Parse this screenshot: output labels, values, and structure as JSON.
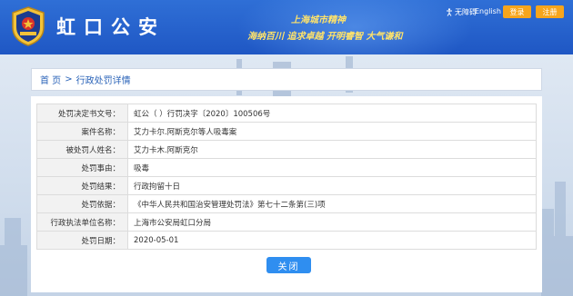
{
  "header": {
    "site_title": "虹口公安",
    "slogan_line1": "上海城市精神",
    "slogan_line2": "海纳百川 追求卓越 开明睿智 大气谦和",
    "accessible_label": "无障碍",
    "english_label": "English",
    "login_label": "登录",
    "register_label": "注册"
  },
  "breadcrumb": {
    "home": "首 页",
    "separator": ">",
    "current": "行政处罚详情"
  },
  "detail": {
    "rows": [
      {
        "label": "处罚决定书文号：",
        "value": "虹公（ ）行罚决字〔2020〕100506号"
      },
      {
        "label": "案件名称：",
        "value": "艾力卡尔.阿斯克尔等人吸毒案"
      },
      {
        "label": "被处罚人姓名：",
        "value": "艾力卡木.阿斯克尔"
      },
      {
        "label": "处罚事由：",
        "value": "吸毒"
      },
      {
        "label": "处罚结果：",
        "value": "行政拘留十日"
      },
      {
        "label": "处罚依据：",
        "value": "《中华人民共和国治安管理处罚法》第七十二条第(三)项"
      },
      {
        "label": "行政执法单位名称：",
        "value": "上海市公安局虹口分局"
      },
      {
        "label": "处罚日期：",
        "value": "2020-05-01"
      }
    ]
  },
  "close_label": "关闭",
  "colors": {
    "header_blue": "#2462cc",
    "accent_orange": "#f7a51c",
    "button_blue": "#2f8ef0",
    "link_blue": "#2a63b8"
  },
  "icons": {
    "emblem": "police-emblem-icon",
    "accessible": "accessibility-icon"
  }
}
